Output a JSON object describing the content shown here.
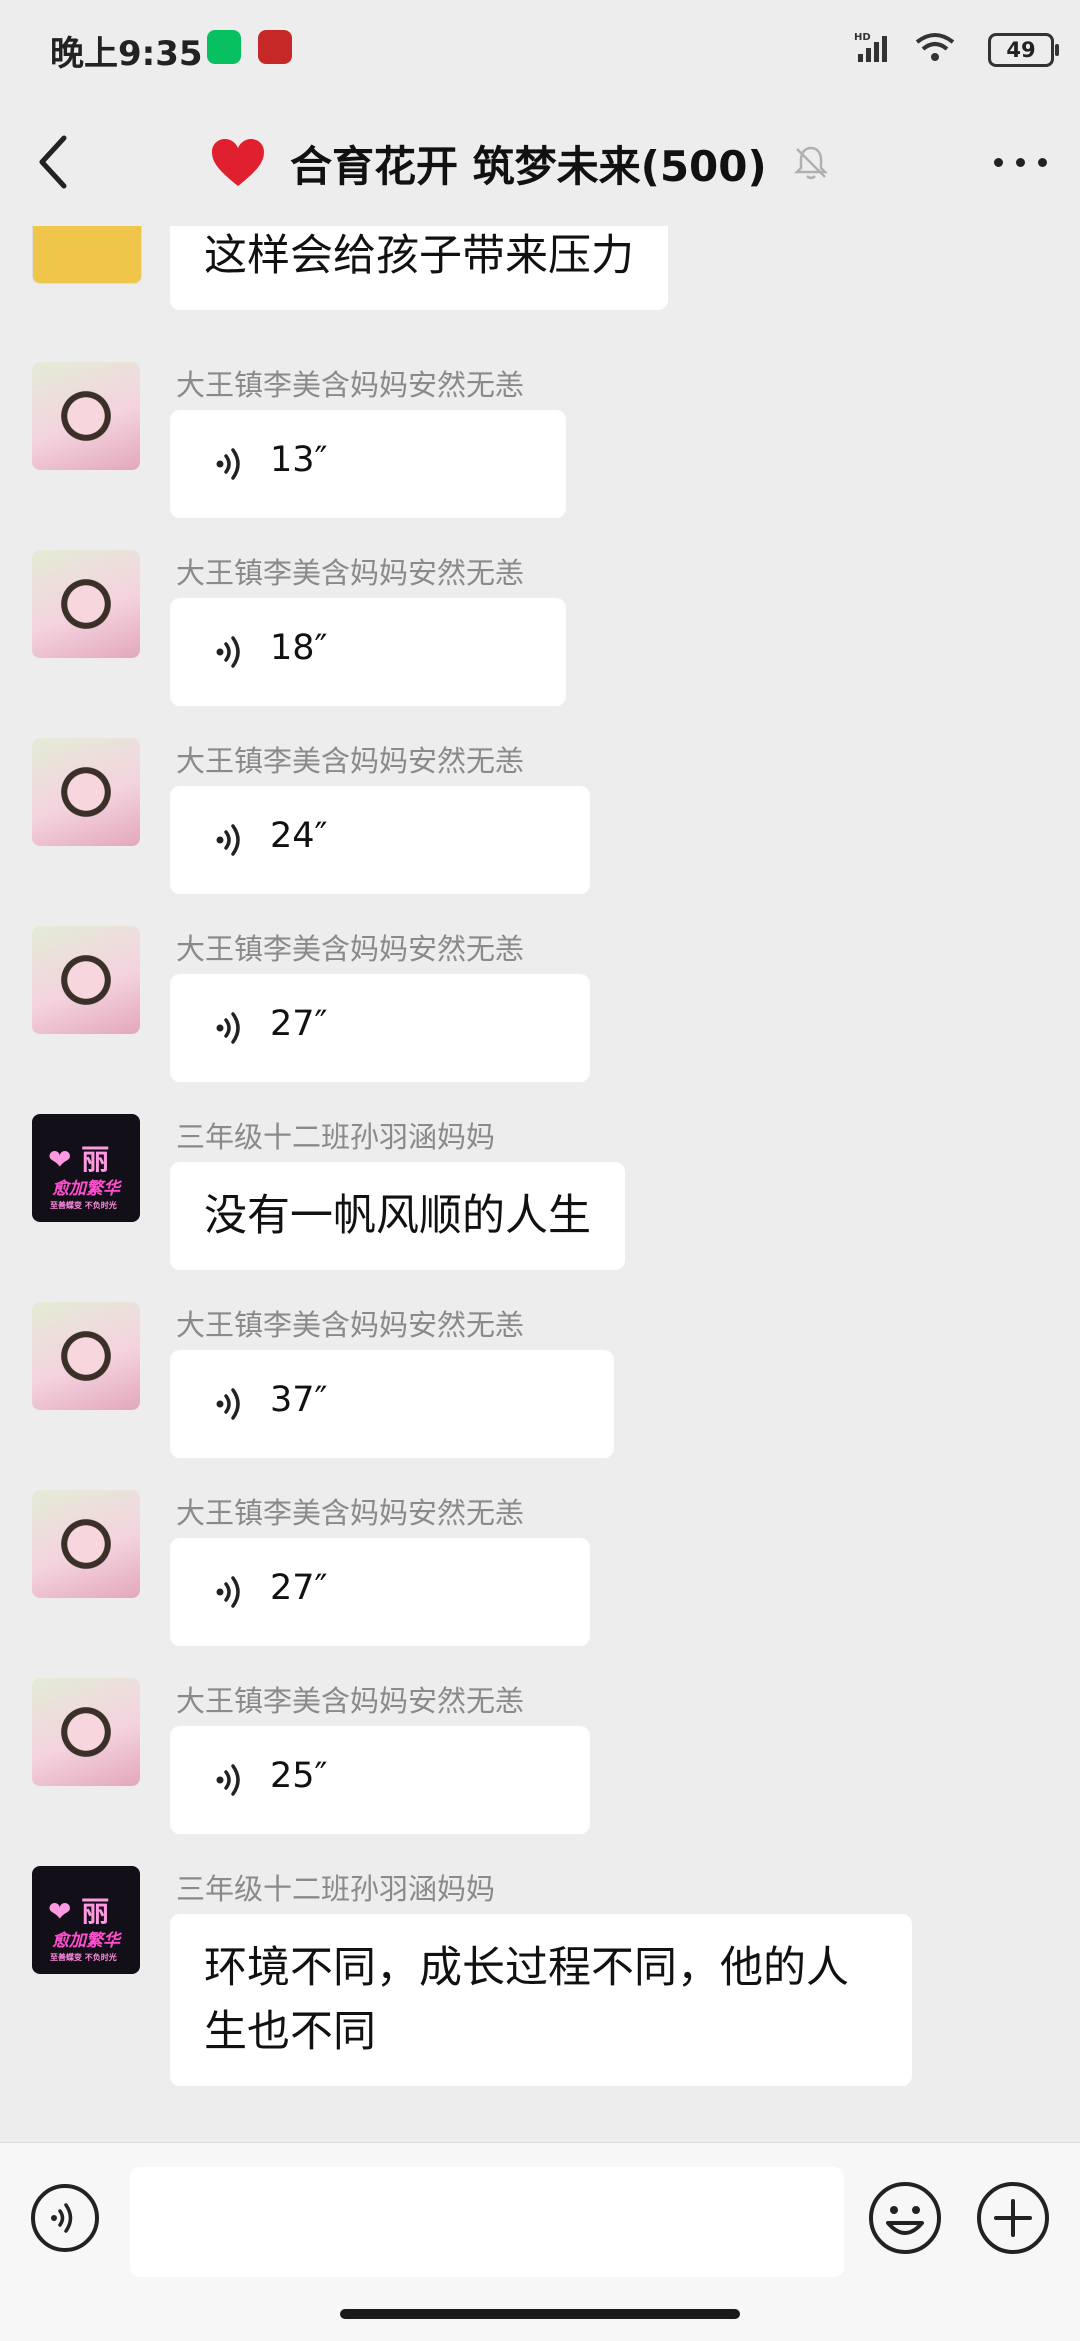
{
  "status_bar": {
    "time": "晚上9:35",
    "signal_label": "HD",
    "battery": "49"
  },
  "header": {
    "title": "合育花开 筑梦未来(500)"
  },
  "messages": [
    {
      "type": "text",
      "sender": "",
      "text": "这样会给孩子带来压力"
    },
    {
      "type": "voice",
      "sender": "大王镇李美含妈妈安然无恙",
      "duration": "13″"
    },
    {
      "type": "voice",
      "sender": "大王镇李美含妈妈安然无恙",
      "duration": "18″"
    },
    {
      "type": "voice",
      "sender": "大王镇李美含妈妈安然无恙",
      "duration": "24″"
    },
    {
      "type": "voice",
      "sender": "大王镇李美含妈妈安然无恙",
      "duration": "27″"
    },
    {
      "type": "text",
      "sender": "三年级十二班孙羽涵妈妈",
      "text": "没有一帆风顺的人生"
    },
    {
      "type": "voice",
      "sender": "大王镇李美含妈妈安然无恙",
      "duration": "37″"
    },
    {
      "type": "voice",
      "sender": "大王镇李美含妈妈安然无恙",
      "duration": "27″"
    },
    {
      "type": "voice",
      "sender": "大王镇李美含妈妈安然无恙",
      "duration": "25″"
    },
    {
      "type": "text",
      "sender": "三年级十二班孙羽涵妈妈",
      "text_line1": "环境不同，成长过程不同，他的人",
      "text_line2": "生也不同"
    }
  ],
  "avatar_text": {
    "neon_heart": "❤ 丽",
    "neon_script": "愈加繁华",
    "neon_small": "至善蝶变 不负时光"
  },
  "colors": {
    "background": "#ededed",
    "bubble": "#ffffff",
    "sender": "#8a8a8a"
  }
}
